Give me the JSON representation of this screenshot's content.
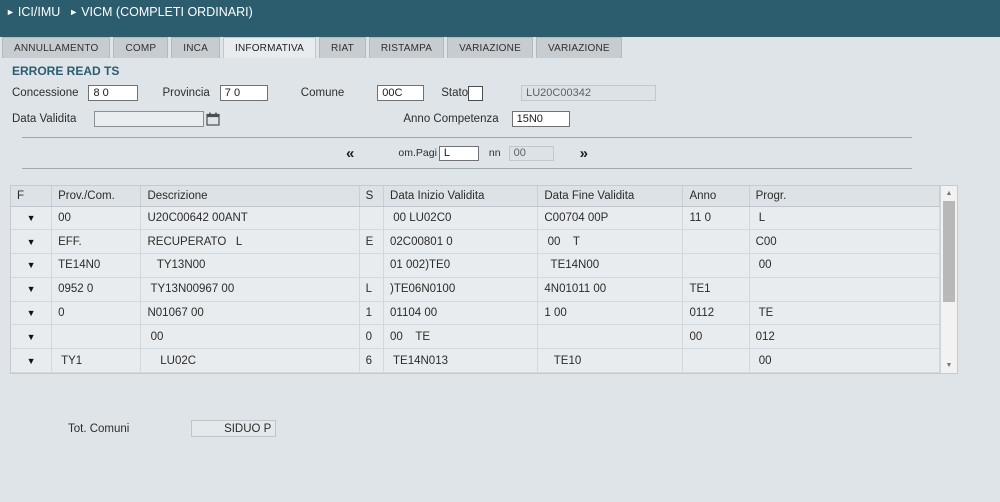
{
  "header": {
    "breadcrumb": [
      {
        "label": "ICI/IMU"
      },
      {
        "label": "VICM (COMPLETI ORDINARI)"
      }
    ]
  },
  "tabs": [
    {
      "label": "ANNULLAMENTO",
      "active": false
    },
    {
      "label": "COMP",
      "active": false
    },
    {
      "label": "INCA",
      "active": false
    },
    {
      "label": "INFORMATIVA",
      "active": true
    },
    {
      "label": "RIAT",
      "active": false
    },
    {
      "label": "RISTAMPA",
      "active": false
    },
    {
      "label": "VARIAZIONE",
      "active": false
    },
    {
      "label": "VARIAZIONE",
      "active": false
    }
  ],
  "status": {
    "message": "ERRORE READ TS"
  },
  "form": {
    "concessione_label": "Concessione",
    "concessione_value": "8 0",
    "provincia_label": "Provincia",
    "provincia_value": "7 0",
    "comune_label": "Comune",
    "comune_value": "00C",
    "stato_label": "Stato",
    "stato_checked": false,
    "codice_value": "LU20C00342",
    "data_validita_label": "Data Validita",
    "data_validita_value": "",
    "calendar_icon": "calendar-icon",
    "anno_competenza_label": "Anno Competenza",
    "anno_competenza_value": "15N0"
  },
  "pager": {
    "prev_icon": "«",
    "next_icon": "»",
    "page_label": "om.Pagi",
    "page_value": "L",
    "count_label": "nn",
    "count_value": "00"
  },
  "table": {
    "columns": [
      {
        "key": "f",
        "label": "F"
      },
      {
        "key": "prov",
        "label": "Prov./Com."
      },
      {
        "key": "desc",
        "label": "Descrizione"
      },
      {
        "key": "s",
        "label": "S"
      },
      {
        "key": "dini",
        "label": "Data Inizio Validita"
      },
      {
        "key": "dfin",
        "label": "Data Fine Validita"
      },
      {
        "key": "anno",
        "label": "Anno"
      },
      {
        "key": "prog",
        "label": "Progr."
      }
    ],
    "rows": [
      {
        "prov": "00",
        "desc": "U20C00642 00ANT",
        "s": "",
        "dini": " 00 LU02C0",
        "dfin": "C00704 00P",
        "anno": "11 0",
        "prog": " L"
      },
      {
        "prov": "EFF.",
        "desc": "RECUPERATO   L",
        "s": "E",
        "dini": "02C00801 0",
        "dfin": " 00    T",
        "anno": "",
        "prog": "C00"
      },
      {
        "prov": "TE14N0",
        "desc": "   TY13N00",
        "s": "",
        "dini": "01 002)TE0",
        "dfin": "  TE14N00",
        "anno": "",
        "prog": " 00"
      },
      {
        "prov": "0952 0",
        "desc": " TY13N00967 00",
        "s": "L",
        "dini": ")TE06N0100",
        "dfin": "4N01011 00",
        "anno": "TE1",
        "prog": ""
      },
      {
        "prov": "0",
        "desc": "N01067 00",
        "s": "1",
        "dini": "01104 00",
        "dfin": "1 00",
        "anno": "0112",
        "prog": " TE"
      },
      {
        "prov": "",
        "desc": " 00",
        "s": "0",
        "dini": "00    TE",
        "dfin": "",
        "anno": "00",
        "prog": "012"
      },
      {
        "prov": " TY1",
        "desc": "    LU02C",
        "s": "6",
        "dini": " TE14N013",
        "dfin": "   TE10",
        "anno": "",
        "prog": " 00"
      }
    ],
    "row_caret_icon": "chevron-down-icon"
  },
  "footer": {
    "tot_comuni_label": "Tot. Comuni",
    "tot_comuni_value": "SIDUO P"
  },
  "scrollbar": {
    "up_icon": "▲",
    "down_icon": "▼"
  },
  "colors": {
    "header_bg": "#2b5d6e",
    "page_bg": "#dfe4e8",
    "tab_bg": "#c7ccd1",
    "tab_active_bg": "#e8ecef",
    "status_text": "#2b5d6e"
  }
}
